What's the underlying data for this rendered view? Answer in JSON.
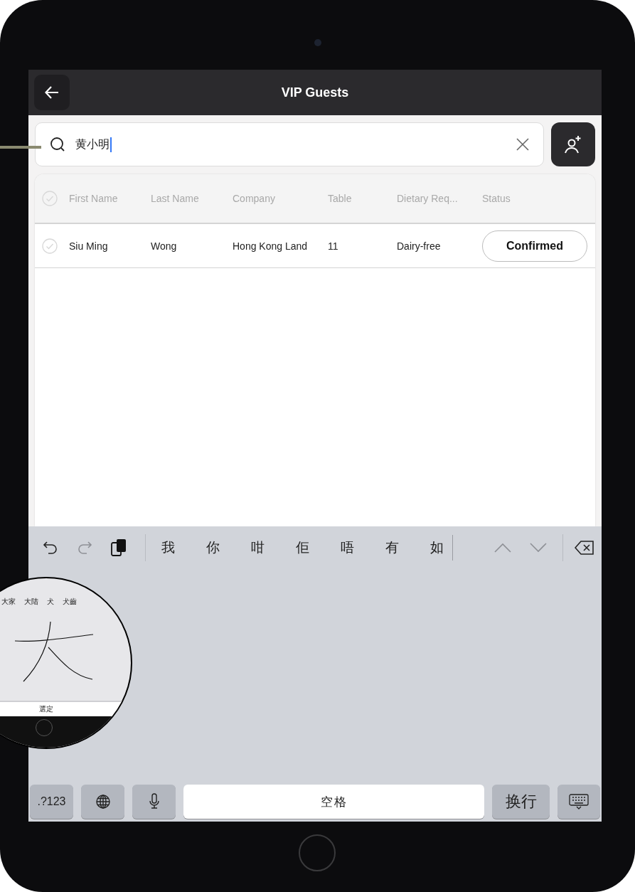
{
  "header": {
    "title": "VIP Guests"
  },
  "search": {
    "value": "黄小明"
  },
  "table": {
    "header_checked": false,
    "columns": [
      "First Name",
      "Last Name",
      "Company",
      "Table",
      "Dietary Req...",
      "Status"
    ],
    "rows": [
      {
        "checked": false,
        "cells": [
          "Siu Ming",
          "Wong",
          "Hong Kong Land",
          "11",
          "Dairy-free"
        ],
        "status": "Confirmed"
      }
    ]
  },
  "keyboard": {
    "candidates": [
      "我",
      "你",
      "咁",
      "佢",
      "唔",
      "有",
      "如"
    ],
    "keys": [
      {
        "kind": "text",
        "label": ".?123"
      },
      {
        "kind": "globe"
      },
      {
        "kind": "mic"
      },
      {
        "kind": "space",
        "label": "空格"
      },
      {
        "kind": "return",
        "label": "换行"
      },
      {
        "kind": "dismiss"
      }
    ]
  },
  "magnifier": {
    "candidates": [
      "大家",
      "大陆",
      "犬",
      "犬齒"
    ],
    "button": "選定"
  }
}
